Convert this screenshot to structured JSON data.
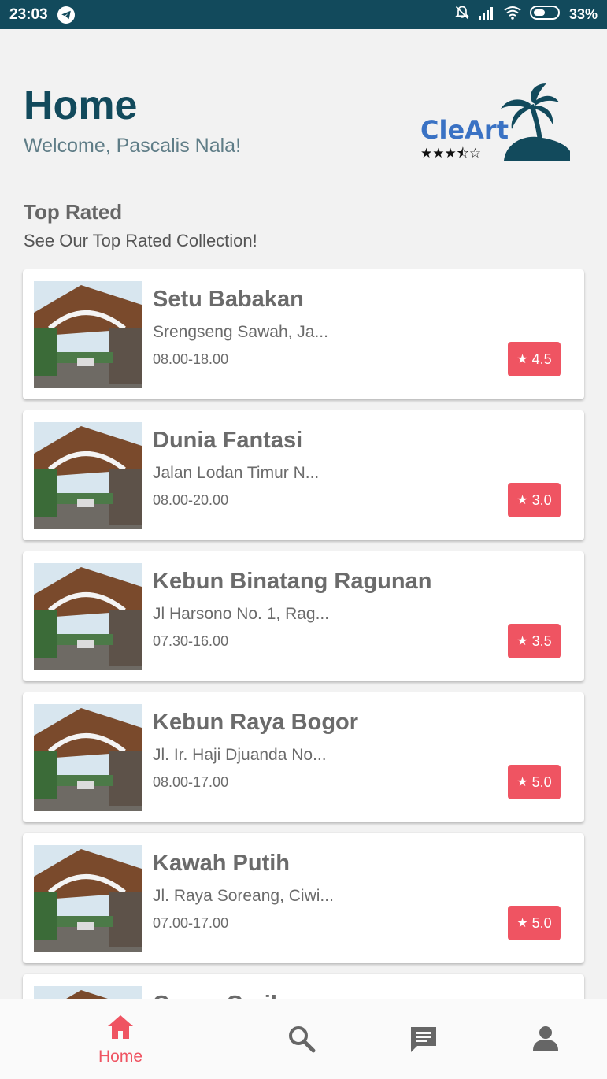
{
  "status_bar": {
    "time": "23:03",
    "battery": "33%"
  },
  "header": {
    "title": "Home",
    "welcome": "Welcome, Pascalis Nala!"
  },
  "logo": {
    "text": "CleArt",
    "stars": "★★★⯪☆"
  },
  "section": {
    "title": "Top Rated",
    "subtitle": "See Our Top Rated Collection!"
  },
  "places": [
    {
      "name": "Setu Babakan",
      "address": "Srengseng Sawah, Ja...",
      "hours": "08.00-18.00",
      "rating": "4.5"
    },
    {
      "name": "Dunia Fantasi",
      "address": "Jalan Lodan Timur N...",
      "hours": "08.00-20.00",
      "rating": "3.0"
    },
    {
      "name": "Kebun Binatang Ragunan",
      "address": "Jl Harsono No. 1, Rag...",
      "hours": "07.30-16.00",
      "rating": "3.5"
    },
    {
      "name": "Kebun Raya Bogor",
      "address": "Jl. Ir.  Haji Djuanda No...",
      "hours": "08.00-17.00",
      "rating": "5.0"
    },
    {
      "name": "Kawah Putih",
      "address": "Jl. Raya Soreang, Ciwi...",
      "hours": "07.00-17.00",
      "rating": "5.0"
    },
    {
      "name": "Curug Cerik",
      "address": "",
      "hours": "",
      "rating": ""
    }
  ],
  "nav": {
    "home": "Home"
  },
  "colors": {
    "primary": "#124a5c",
    "accent": "#ef5462",
    "logo_blue": "#3a72c4"
  },
  "icons": [
    "telegram-icon",
    "mute-icon",
    "signal-icon",
    "wifi-icon",
    "battery-icon",
    "star-icon",
    "home-icon",
    "search-icon",
    "chat-icon",
    "profile-icon"
  ]
}
